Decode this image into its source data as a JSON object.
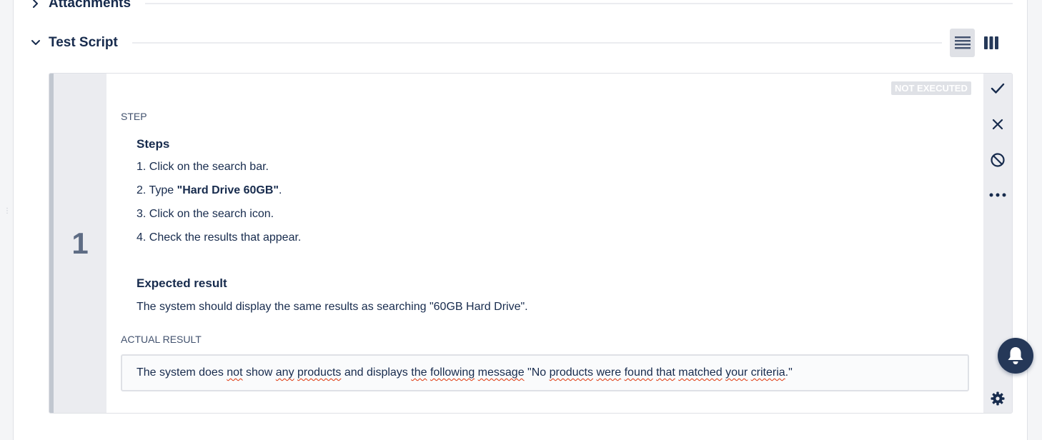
{
  "sections": {
    "attachments": {
      "title": "Attachments"
    },
    "test_script": {
      "title": "Test Script"
    }
  },
  "view_modes": [
    {
      "icon": "list-view-icon",
      "active": true
    },
    {
      "icon": "columns-view-icon",
      "active": false
    }
  ],
  "step": {
    "number": "1",
    "status": "NOT EXECUTED",
    "step_label": "STEP",
    "steps_heading": "Steps",
    "steps": [
      "1. Click on the search bar.",
      "2. Type ",
      "3. Click on the search icon.",
      "4. Check the results that appear."
    ],
    "step2_bold": "\"Hard Drive 60GB\"",
    "step2_tail": ".",
    "expected_heading": "Expected result",
    "expected_text": "The system should display the same results as searching \"60GB Hard Drive\".",
    "actual_label": "ACTUAL RESULT",
    "actual_parts": [
      "The system does ",
      "not",
      " show ",
      "any",
      " ",
      "products",
      " and displays ",
      "the",
      " ",
      "following",
      " ",
      "message",
      " \"No ",
      "products",
      " ",
      "were",
      " ",
      "found",
      " ",
      "that",
      " ",
      "matched",
      " ",
      "your",
      " ",
      "criteria",
      ".\""
    ]
  },
  "step_actions": [
    {
      "name": "pass",
      "icon": "check-icon"
    },
    {
      "name": "fail",
      "icon": "close-icon"
    },
    {
      "name": "block",
      "icon": "blocked-icon"
    },
    {
      "name": "more",
      "icon": "more-icon"
    }
  ],
  "colors": {
    "text": "#172b4d",
    "muted": "#42526e",
    "badge_bg": "#dfe1e6",
    "number_col": "#ebecf0",
    "notification": "#253858",
    "spell_error": "#de350b"
  }
}
